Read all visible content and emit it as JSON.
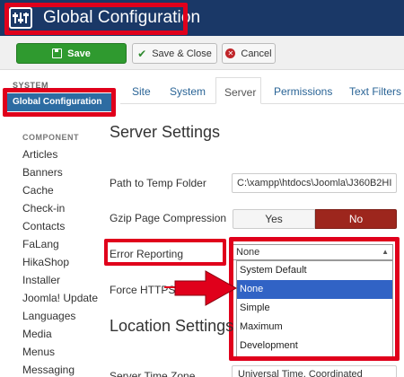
{
  "header": {
    "title": "Global Configuration",
    "logo_icon": "joomla-sliders-icon"
  },
  "toolbar": {
    "save_label": "Save",
    "save_close_label": "Save & Close",
    "cancel_label": "Cancel",
    "save_color": "#2f9a2f"
  },
  "sidebar": {
    "system_label": "SYSTEM",
    "global_item": "Global Configuration",
    "component_label": "COMPONENT",
    "items": [
      "Articles",
      "Banners",
      "Cache",
      "Check-in",
      "Contacts",
      "FaLang",
      "HikaShop",
      "Installer",
      "Joomla! Update",
      "Languages",
      "Media",
      "Menus",
      "Messaging"
    ]
  },
  "tabs": {
    "items": [
      "Site",
      "System",
      "Server",
      "Permissions",
      "Text Filters"
    ],
    "active": "Server"
  },
  "server": {
    "title": "Server Settings",
    "temp_folder_label": "Path to Temp Folder",
    "temp_folder_value": "C:\\xampp\\htdocs\\Joomla\\J360B2HI",
    "gzip_label": "Gzip Page Compression",
    "gzip_yes": "Yes",
    "gzip_no": "No",
    "error_label": "Error Reporting",
    "error_value": "None",
    "error_options": [
      "System Default",
      "None",
      "Simple",
      "Maximum",
      "Development"
    ],
    "error_selected": "None",
    "https_label": "Force HTTPS"
  },
  "location": {
    "title": "Location Settings",
    "timezone_label": "Server Time Zone",
    "timezone_value": "Universal Time, Coordinated"
  },
  "colors": {
    "header": "#1a3867",
    "highlight": "#e0001b",
    "selected_option": "#3163c5",
    "no_active": "#9d261d"
  }
}
